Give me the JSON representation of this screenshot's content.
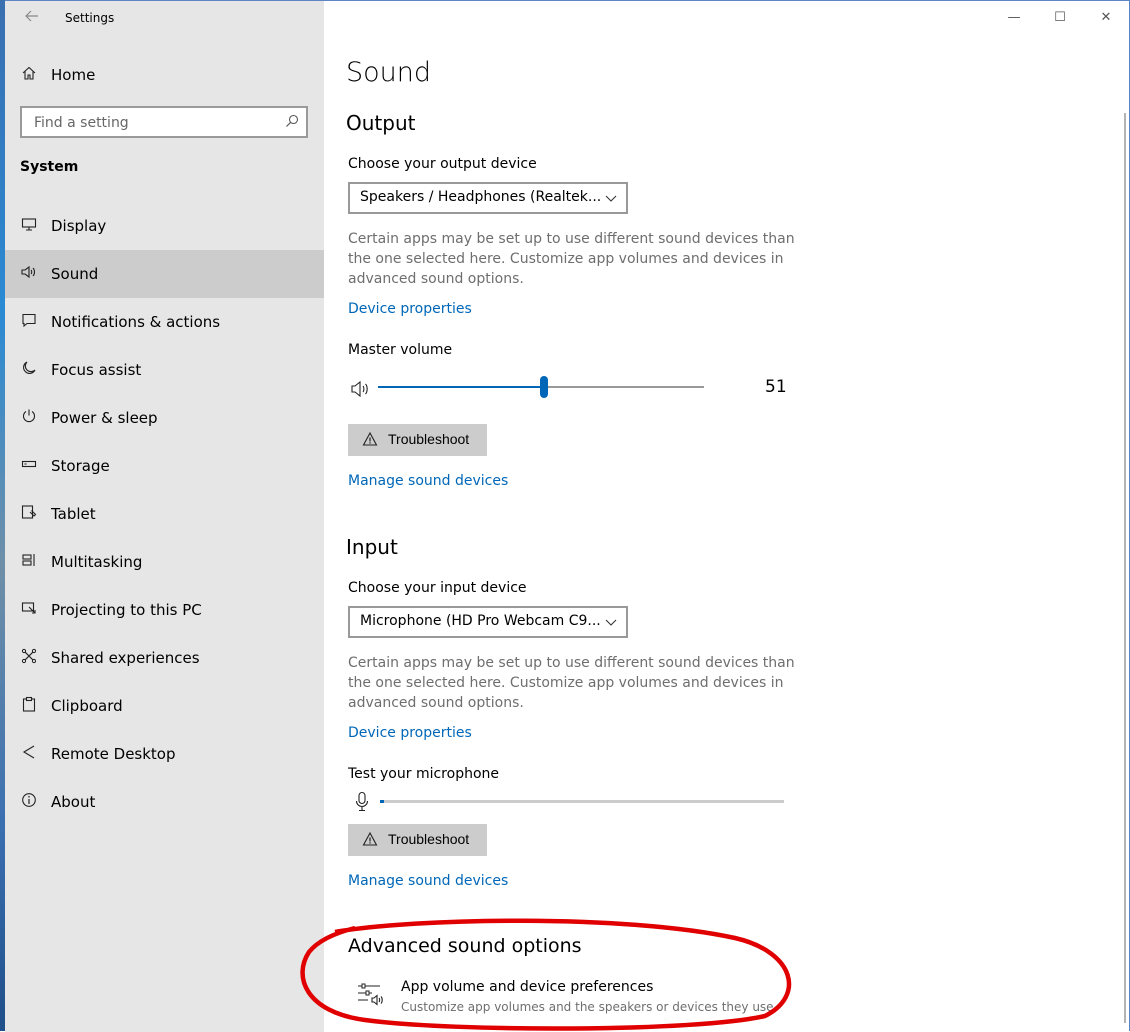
{
  "window": {
    "title": "Settings",
    "controls": {
      "minimize": "—",
      "maximize": "☐",
      "close": "✕"
    }
  },
  "sidebar": {
    "home_label": "Home",
    "search": {
      "placeholder": "Find a setting"
    },
    "section_heading": "System",
    "items": [
      {
        "label": "Display",
        "icon": "display-icon",
        "selected": false
      },
      {
        "label": "Sound",
        "icon": "speaker-icon",
        "selected": true
      },
      {
        "label": "Notifications & actions",
        "icon": "notifications-icon",
        "selected": false
      },
      {
        "label": "Focus assist",
        "icon": "moon-icon",
        "selected": false
      },
      {
        "label": "Power & sleep",
        "icon": "power-icon",
        "selected": false
      },
      {
        "label": "Storage",
        "icon": "storage-icon",
        "selected": false
      },
      {
        "label": "Tablet",
        "icon": "tablet-icon",
        "selected": false
      },
      {
        "label": "Multitasking",
        "icon": "multitasking-icon",
        "selected": false
      },
      {
        "label": "Projecting to this PC",
        "icon": "projecting-icon",
        "selected": false
      },
      {
        "label": "Shared experiences",
        "icon": "shared-experiences-icon",
        "selected": false
      },
      {
        "label": "Clipboard",
        "icon": "clipboard-icon",
        "selected": false
      },
      {
        "label": "Remote Desktop",
        "icon": "remote-desktop-icon",
        "selected": false
      },
      {
        "label": "About",
        "icon": "info-icon",
        "selected": false
      }
    ]
  },
  "main": {
    "title": "Sound",
    "output": {
      "heading": "Output",
      "device_label": "Choose your output device",
      "device_value": "Speakers / Headphones (Realtek...",
      "description": "Certain apps may be set up to use different sound devices than the one selected here. Customize app volumes and devices in advanced sound options.",
      "device_properties_link": "Device properties",
      "master_volume_label": "Master volume",
      "master_volume": 51,
      "master_volume_text": "51",
      "troubleshoot_label": "Troubleshoot",
      "manage_link": "Manage sound devices"
    },
    "input": {
      "heading": "Input",
      "device_label": "Choose your input device",
      "device_value": "Microphone (HD Pro Webcam C9...",
      "description": "Certain apps may be set up to use different sound devices than the one selected here. Customize app volumes and devices in advanced sound options.",
      "device_properties_link": "Device properties",
      "test_label": "Test your microphone",
      "mic_level": 1,
      "troubleshoot_label": "Troubleshoot",
      "manage_link": "Manage sound devices"
    },
    "advanced": {
      "heading": "Advanced sound options",
      "item_title": "App volume and device preferences",
      "item_subtitle": "Customize app volumes and the speakers or devices they use."
    }
  },
  "colors": {
    "accent": "#0067b8",
    "sidebar_bg": "#e6e6e6",
    "selected_bg": "#cccccc",
    "annotation": "#e00000"
  }
}
